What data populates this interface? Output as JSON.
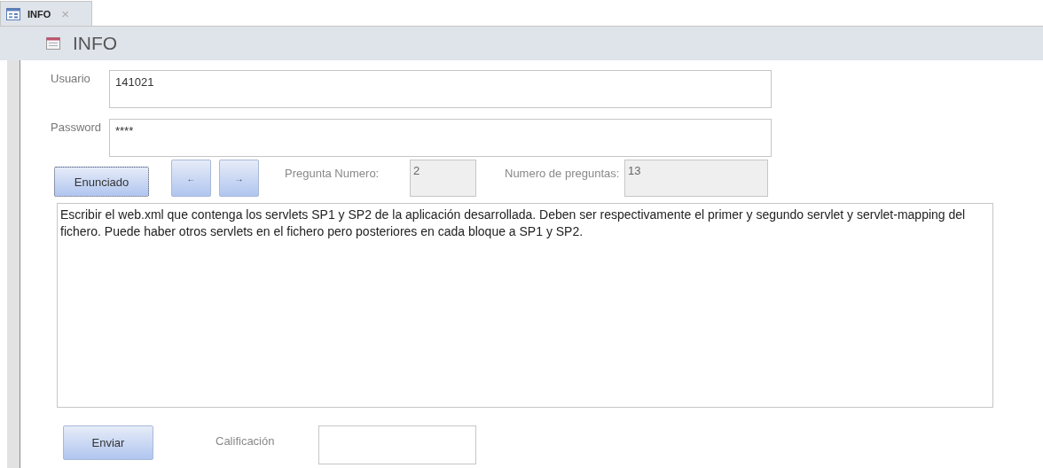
{
  "tab": {
    "label": "INFO",
    "selected": true,
    "close": "×"
  },
  "header": {
    "title": "INFO"
  },
  "fields": [
    {
      "label": "Usuario",
      "value": "141021"
    },
    {
      "label": "Password",
      "value": "****"
    }
  ],
  "buttons": {
    "statement": "Enunciado",
    "previous": "←",
    "next": "→",
    "submit": "Enviar"
  },
  "question_number": {
    "label": "Pregunta Numero:",
    "value": "2"
  },
  "question_count": {
    "label": "Numero de preguntas:",
    "value": "13"
  },
  "statement_text": "Escribir el web.xml que contenga los servlets SP1 y SP2 de la aplicación desarrollada. Deben ser respectivamente el primer y segundo servlet y servlet-mapping del fichero. Puede haber otros servlets en el fichero pero posteriores en cada bloque a SP1 y SP2.",
  "grade": {
    "label": "Calificación"
  }
}
